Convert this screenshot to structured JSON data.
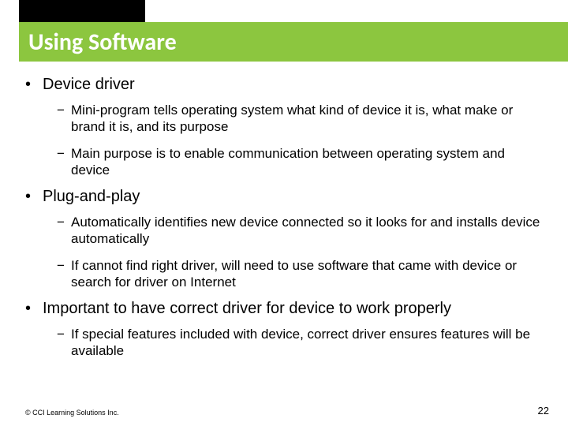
{
  "header": {
    "title": "Using Software"
  },
  "content": {
    "b1": {
      "text": "Device driver",
      "sub1": "Mini-program tells operating system what kind of device it is, what make or brand it is, and its purpose",
      "sub2": "Main purpose is to enable communication between operating system and device"
    },
    "b2": {
      "text": "Plug-and-play",
      "sub1": "Automatically identifies new device connected so it looks for and installs device automatically",
      "sub2": "If cannot find right driver, will need to use software that came with device or search for driver on Internet"
    },
    "b3": {
      "text": "Important to have correct driver for device to work properly",
      "sub1": "If special features included with device, correct driver ensures features will be available"
    }
  },
  "footer": {
    "copyright": "© CCI Learning Solutions Inc.",
    "page": "22"
  }
}
